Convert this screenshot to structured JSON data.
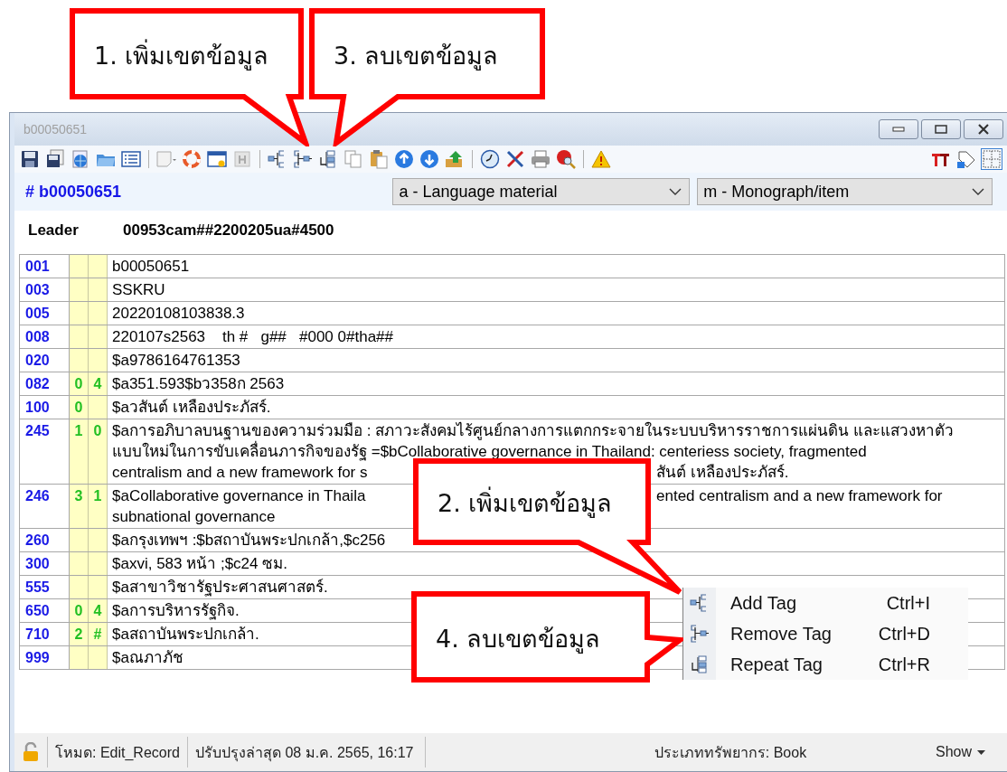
{
  "callouts": [
    {
      "text": "1. เพิ่มเขตข้อมูล"
    },
    {
      "text": "3. ลบเขตข้อมูล"
    },
    {
      "text": "2. เพิ่มเขตข้อมูล"
    },
    {
      "text": "4. ลบเขตข้อมูล"
    }
  ],
  "window": {
    "title": "b00050651"
  },
  "record": {
    "id": "# b00050651"
  },
  "selects": [
    {
      "value": "a - Language material"
    },
    {
      "value": "m - Monograph/item"
    }
  ],
  "leader": {
    "label": "Leader",
    "value": "00953cam##2200205ua#4500"
  },
  "fields": [
    {
      "tag": "001",
      "lines": [
        [
          "b00050651"
        ]
      ]
    },
    {
      "tag": "003",
      "lines": [
        [
          "SSKRU"
        ]
      ]
    },
    {
      "tag": "005",
      "lines": [
        [
          "20220108103838.3"
        ]
      ]
    },
    {
      "tag": "008",
      "lines": [
        [
          "220107s2563    th #   g##   #000 0#tha##"
        ]
      ]
    },
    {
      "tag": "020",
      "lines": [
        [
          "$a9786164761353"
        ]
      ]
    },
    {
      "tag": "082",
      "ind1": "0",
      "ind2": "4",
      "lines": [
        [
          "$a351.593$bว358ก 2563"
        ]
      ]
    },
    {
      "tag": "100",
      "ind1": "0",
      "lines": [
        [
          "$aวสันต์ เหลืองประภัสร์."
        ]
      ]
    },
    {
      "tag": "245",
      "ind1": "1",
      "ind2": "0",
      "lines": [
        [
          "$aการอภิบาลบนฐานของความร่วมมือ : สภาวะสังคมไร้ศูนย์กลางการแตกกระจายในระบบบริหารราชการแผ่นดิน และแสวงหาตัว"
        ],
        [
          "แบบใหม่ในการขับเคลื่อนภารกิจของรัฐ =$bCollaborative governance in Thailand: centeriess society, fragmented"
        ],
        [
          "centralism and a new framework for s",
          "สันต์ เหลืองประภัสร์."
        ]
      ]
    },
    {
      "tag": "246",
      "ind1": "3",
      "ind2": "1",
      "lines": [
        [
          "$aCollaborative governance in Thaila",
          "ented centralism and a new framework for"
        ],
        [
          "subnational governance"
        ]
      ]
    },
    {
      "tag": "260",
      "lines": [
        [
          "$aกรุงเทพฯ :$bสถาบันพระปกเกล้า,$c256"
        ]
      ]
    },
    {
      "tag": "300",
      "lines": [
        [
          "$axvi, 583 หน้า ;$c24 ซม."
        ]
      ]
    },
    {
      "tag": "555",
      "lines": [
        [
          "$aสาขาวิชารัฐประศาสนศาสตร์."
        ]
      ]
    },
    {
      "tag": "650",
      "ind1": "0",
      "ind2": "4",
      "lines": [
        [
          "$aการบริหารรัฐกิจ."
        ]
      ]
    },
    {
      "tag": "710",
      "ind1": "2",
      "ind2": "#",
      "lines": [
        [
          "$aสถาบันพระปกเกล้า."
        ]
      ]
    },
    {
      "tag": "999",
      "lines": [
        [
          "$aณภาภัช"
        ]
      ]
    }
  ],
  "context_menu": [
    {
      "kind": "add",
      "label": "Add Tag",
      "shortcut": "Ctrl+I"
    },
    {
      "kind": "remove",
      "label": "Remove Tag",
      "shortcut": "Ctrl+D"
    },
    {
      "kind": "repeat",
      "label": "Repeat Tag",
      "shortcut": "Ctrl+R"
    }
  ],
  "status_bar": {
    "mode": "โหมด: Edit_Record",
    "updated": "ปรับปรุงล่าสุด 08  ม.ค. 2565, 16:17",
    "resource_type": "ประเภททรัพยากร: Book",
    "show": "Show"
  }
}
